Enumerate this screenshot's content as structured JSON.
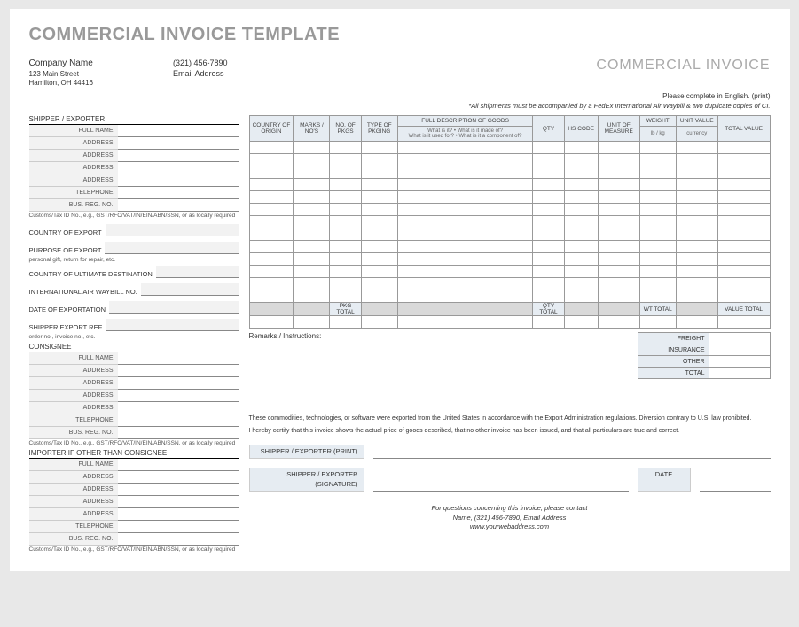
{
  "template_title": "COMMERCIAL INVOICE TEMPLATE",
  "company": {
    "name": "Company Name",
    "street": "123 Main Street",
    "city": "Hamilton, OH  44416",
    "phone": "(321) 456-7890",
    "email": "Email Address"
  },
  "invoice_title": "COMMERCIAL INVOICE",
  "instruction": "Please complete in English. (print)",
  "waybill_note": "*All shipments must be accompanied by a FedEx International Air Waybill & two duplicate copies of CI.",
  "left": {
    "shipper_head": "SHIPPER / EXPORTER",
    "fields": [
      "FULL NAME",
      "ADDRESS",
      "ADDRESS",
      "ADDRESS",
      "ADDRESS",
      "TELEPHONE",
      "BUS. REG. NO."
    ],
    "customs_note": "Customs/Tax ID No., e.g., GST/RFC/VAT/IN/EIN/ABN/SSN, or as locally required",
    "country_export": "COUNTRY OF EXPORT",
    "purpose_export": "PURPOSE OF EXPORT",
    "purpose_note": "personal gift, return for repair, etc.",
    "ultimate_dest": "COUNTRY OF ULTIMATE DESTINATION",
    "air_waybill": "INTERNATIONAL AIR WAYBILL NO.",
    "date_export": "DATE OF EXPORTATION",
    "shipper_ref": "SHIPPER EXPORT REF",
    "shipper_ref_note": "order no., invoice no., etc.",
    "consignee_head": "CONSIGNEE",
    "importer_head": "IMPORTER IF OTHER THAN CONSIGNEE"
  },
  "table": {
    "headers": {
      "country": "COUNTRY OF ORIGIN",
      "marks": "MARKS / NO'S",
      "pkgs": "NO. OF PKGS",
      "pkging": "TYPE OF PKGING",
      "desc": "FULL DESCRIPTION OF GOODS",
      "desc_sub": "What is it? • What is it made of?\nWhat is it used for? • What is it a component of?",
      "qty": "QTY",
      "hs": "HS CODE",
      "uom": "UNIT OF MEASURE",
      "weight": "WEIGHT",
      "weight_sub": "lb / kg",
      "unit_value": "UNIT VALUE",
      "unit_value_sub": "currency",
      "total_value": "TOTAL VALUE"
    },
    "totals": {
      "pkg": "PKG TOTAL",
      "qty": "QTY TOTAL",
      "wt": "WT TOTAL",
      "value": "VALUE TOTAL"
    }
  },
  "remarks_label": "Remarks / Instructions:",
  "summary": {
    "freight": "FREIGHT",
    "insurance": "INSURANCE",
    "other": "OTHER",
    "total": "TOTAL"
  },
  "cert": {
    "line1": "These commodities, technologies, or software were exported from the United States in accordance with the Export Administration regulations. Diversion contrary to U.S. law prohibited.",
    "line2": "I hereby certify that this invoice shows the actual price of goods described, that no other invoice has been issued, and that all particulars are true and correct.",
    "print_label": "SHIPPER / EXPORTER (PRINT)",
    "sig_label": "SHIPPER / EXPORTER (SIGNATURE)",
    "date_label": "DATE"
  },
  "footer": {
    "line1": "For questions concerning this invoice, please contact",
    "line2": "Name, (321) 456-7890, Email Address",
    "line3": "www.yourwebaddress.com"
  }
}
